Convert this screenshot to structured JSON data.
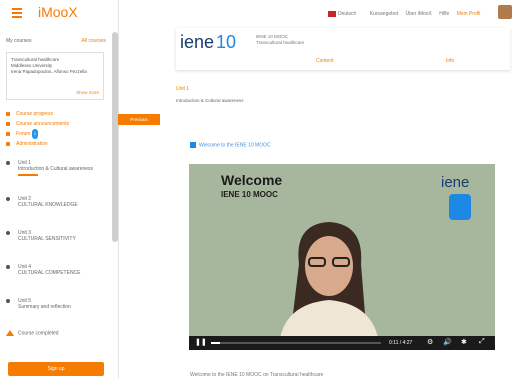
{
  "topbar": {
    "logo": "iMooX",
    "links": [
      "Deutsch",
      "Kursangebot",
      "Über iMooX",
      "Hilfe"
    ],
    "user": "Mein Profil"
  },
  "sidebar": {
    "heading": "My courses",
    "heading_right": "All courses",
    "course_card": {
      "title": "Transcultural healthcare",
      "lines": [
        "Middlesex University",
        "Irena Papadopoulos, Alfonso Pezzella"
      ],
      "more": "Show more"
    },
    "nav": [
      {
        "label": "Course progress"
      },
      {
        "label": "Course announcements"
      },
      {
        "label": "Forum",
        "badge": "1"
      },
      {
        "label": "Administration"
      }
    ],
    "units": [
      {
        "label": "Unit 1",
        "sub": "Introduction & Cultural awareness"
      },
      {
        "label": "Unit 2",
        "sub": "CULTURAL KNOWLEDGE"
      },
      {
        "label": "Unit 3",
        "sub": "CULTURAL SENSITIVITY"
      },
      {
        "label": "Unit 4",
        "sub": "CULTURAL COMPETENCE"
      },
      {
        "label": "Unit 5",
        "sub": "Summary and reflection"
      }
    ],
    "coin_label": "Course completed",
    "button": "Sign up"
  },
  "tab_label": "Previous",
  "header_card": {
    "logo": "iene",
    "logo_num": "10",
    "text_lines": [
      "IENE 10 MOOC",
      "Transcultural healthcare"
    ],
    "link_left": "Content",
    "link_right": "Info"
  },
  "section_link": "Unit 1",
  "crumb": "Introduction & Cultural awareness",
  "video": {
    "title": "Welcome to the IENE 10 MOOC",
    "welcome": "Welcome",
    "sub": "IENE 10 MOOC",
    "logo": "iene",
    "time": "0:11 / 4:27",
    "progress": 0.05
  },
  "bottom_text": "Welcome to the IENE 10 MOOC on Transcultural healthcare"
}
